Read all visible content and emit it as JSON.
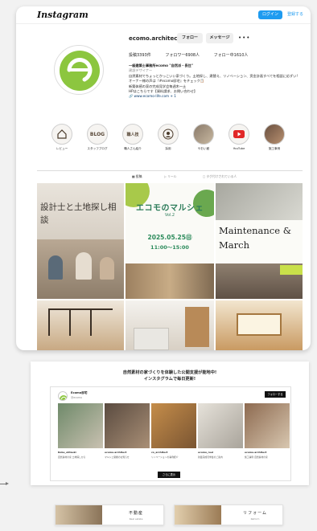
{
  "header": {
    "logo": "Instagram",
    "login_label": "ログイン",
    "signup_label": "登録する"
  },
  "profile": {
    "username": "ecomo.architect",
    "follow_label": "フォロー",
    "message_label": "メッセージ",
    "more_label": "•••",
    "posts": "投稿3393件",
    "followers": "フォロワー6908人",
    "following": "フォロー中1610人",
    "bio": [
      "一級建築士事務所ecomo \"自然派・長住\"",
      "建設デザイナー",
      "自然素材でちょっとかっこいい家づくり。土地探し、建替え、リノベーション、资金計画すべてを相談に応ずい!",
      "オーナー様の声は『#ecomo邸宅』をチェック📋",
      "新築体感の家の完成見学会毎週木～土",
      "HPはこちらです【資料請求、お問い合わせ】",
      "🔗 www.ecomo-life.com + 1"
    ]
  },
  "highlights": [
    {
      "label": "レビュー",
      "icon": "house-icon"
    },
    {
      "label": "スタッフブログ",
      "icon": "BLOG"
    },
    {
      "label": "職人さん紹介",
      "icon": "職人技"
    },
    {
      "label": "採用",
      "icon": "person-icon"
    },
    {
      "label": "やおい館",
      "icon": "photo"
    },
    {
      "label": "YouTube",
      "icon": "youtube-icon"
    },
    {
      "label": "施工事例",
      "icon": "photo"
    }
  ],
  "tabs": [
    {
      "label": "投稿",
      "active": true
    },
    {
      "label": "リール",
      "active": false
    },
    {
      "label": "タグ付けされている人",
      "active": false
    }
  ],
  "posts_grid": [
    {
      "text": "設計士と土地探し相談"
    },
    {
      "text": "エコモのマルシェ",
      "sub": "Vol.2",
      "date": "2025.05.25㊐",
      "time": "11:00〜15:00"
    },
    {
      "text": "Maintenance & March"
    },
    {
      "text": ""
    },
    {
      "text": ""
    },
    {
      "text": ""
    }
  ],
  "website": {
    "promo_line1": "自然素材の家づくりを体験した公開支援が能地中!",
    "promo_line2": "インスタグラムで毎日更新!",
    "embed_name": "Ecomo邸宅",
    "embed_handle": "@ecomo",
    "embed_follow": "フォローする",
    "load_more": "さらに表示",
    "posts": [
      {
        "user": "Kobe_ohtsuki",
        "text": "自然素材の家 土地探しから"
      },
      {
        "user": "ecomo.architect",
        "text": "マルシェ開催のお知らせ"
      },
      {
        "user": "co_architect",
        "text": "リノベーションの事例紹介"
      },
      {
        "user": "ecomo_reel",
        "text": "新築完成見学会のご案内"
      },
      {
        "user": "ecomo.architect",
        "text": "施工事例 自然素材の家"
      }
    ],
    "banners": [
      {
        "title": "不動産",
        "sub": "Real estate"
      },
      {
        "title": "リフォーム",
        "sub": "Reform"
      }
    ]
  },
  "colors": {
    "accent": "#1e9bf0",
    "brand_green": "#8cc63f",
    "dark": "#111111"
  }
}
